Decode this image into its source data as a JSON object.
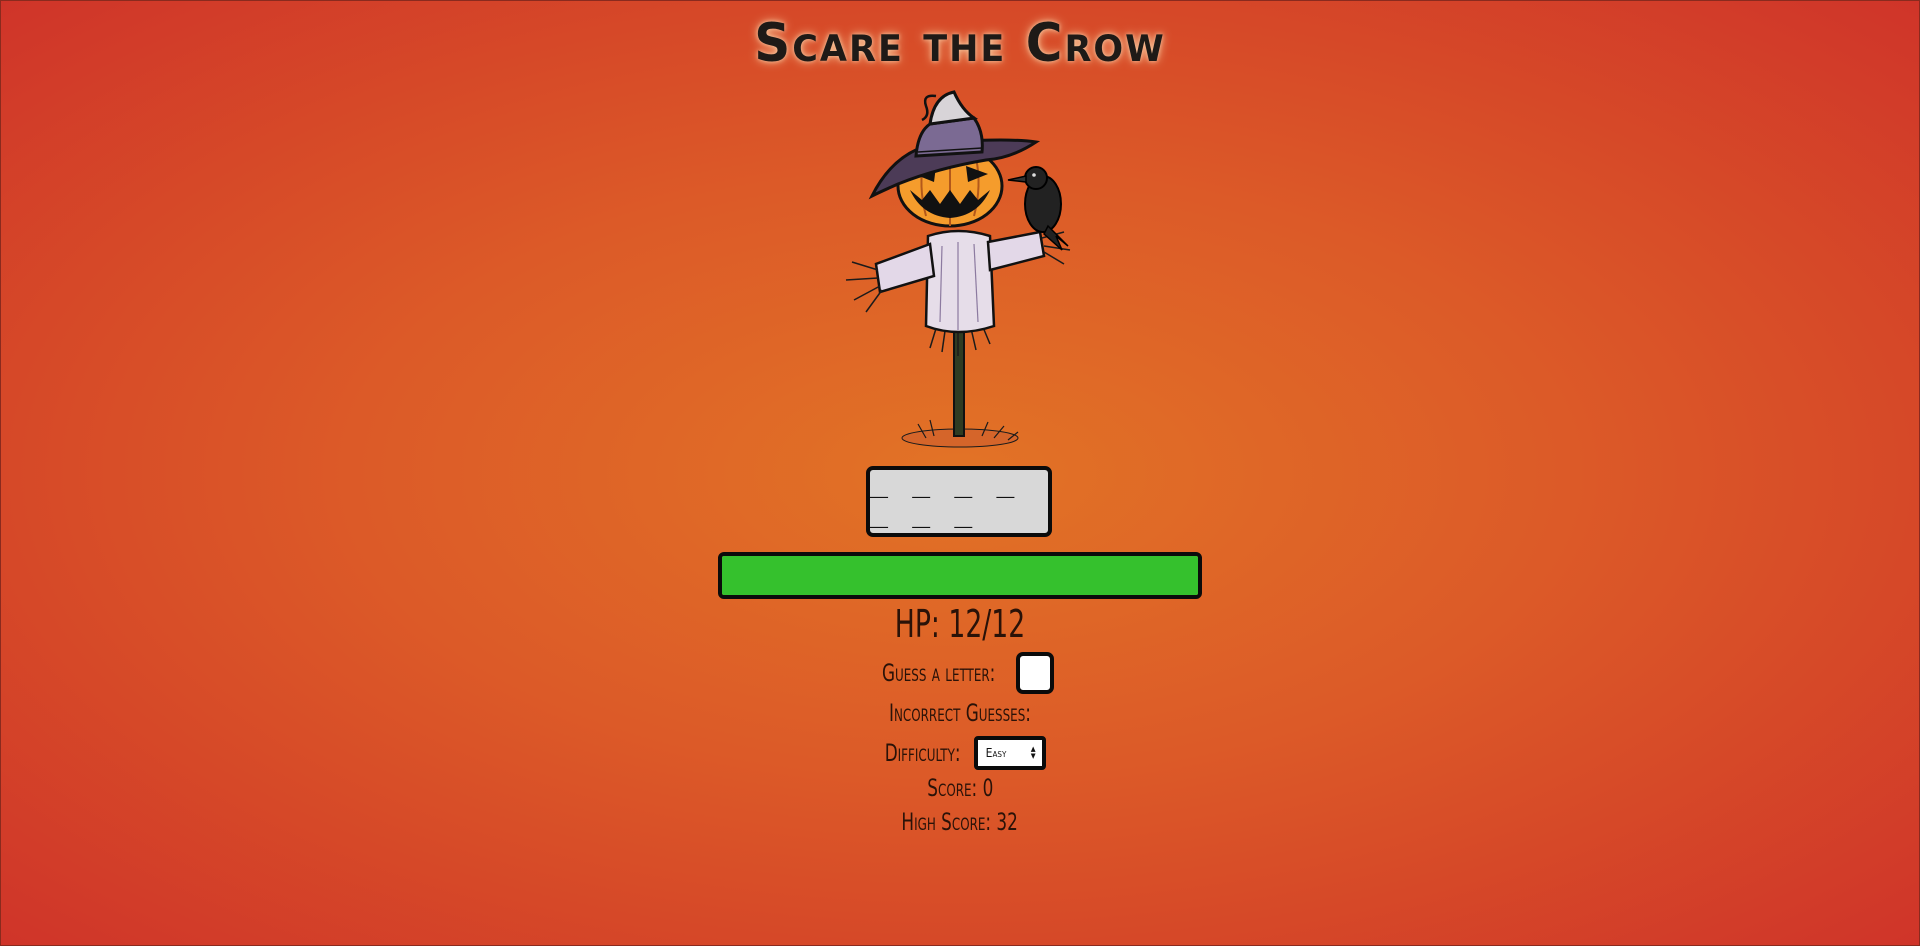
{
  "title": "Scare the Crow",
  "word_display": "_ _ _ _ _ _ _",
  "hp": {
    "label": "HP: 12/12",
    "current": 12,
    "max": 12,
    "fill_fraction": 1.0,
    "bar_color": "#35c12d"
  },
  "guess": {
    "label": "Guess a letter:",
    "value": ""
  },
  "incorrect": {
    "label": "Incorrect Guesses:"
  },
  "difficulty": {
    "label": "Difficulty:",
    "selected": "Easy"
  },
  "score": {
    "label": "Score: 0"
  },
  "high_score": {
    "label": "High Score: 32"
  },
  "icons": {
    "scarecrow": "pumpkin-scarecrow-with-crow-illustration",
    "select_arrows": "up-down-arrows-icon"
  }
}
